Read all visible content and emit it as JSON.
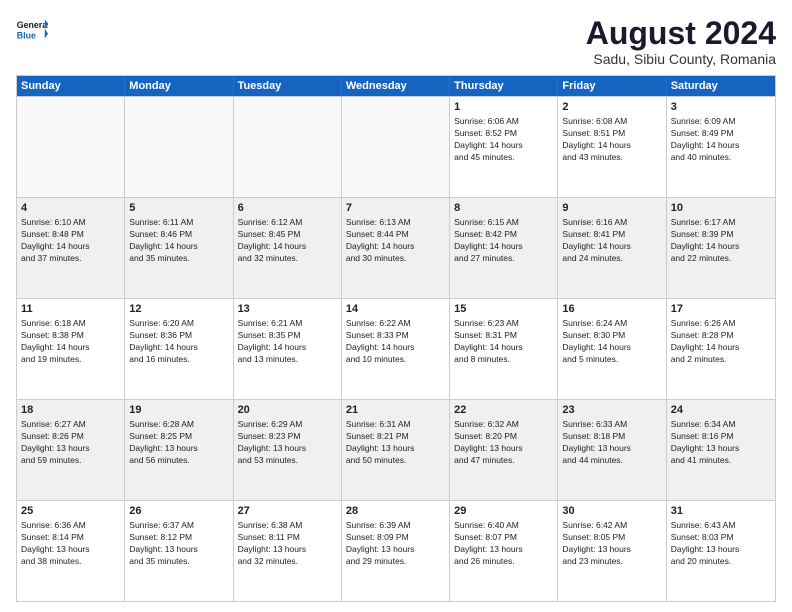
{
  "logo": {
    "line1": "General",
    "line2": "Blue"
  },
  "header": {
    "title": "August 2024",
    "subtitle": "Sadu, Sibiu County, Romania"
  },
  "days": [
    "Sunday",
    "Monday",
    "Tuesday",
    "Wednesday",
    "Thursday",
    "Friday",
    "Saturday"
  ],
  "weeks": [
    [
      {
        "day": "",
        "info": ""
      },
      {
        "day": "",
        "info": ""
      },
      {
        "day": "",
        "info": ""
      },
      {
        "day": "",
        "info": ""
      },
      {
        "day": "1",
        "info": "Sunrise: 6:06 AM\nSunset: 8:52 PM\nDaylight: 14 hours\nand 45 minutes."
      },
      {
        "day": "2",
        "info": "Sunrise: 6:08 AM\nSunset: 8:51 PM\nDaylight: 14 hours\nand 43 minutes."
      },
      {
        "day": "3",
        "info": "Sunrise: 6:09 AM\nSunset: 8:49 PM\nDaylight: 14 hours\nand 40 minutes."
      }
    ],
    [
      {
        "day": "4",
        "info": "Sunrise: 6:10 AM\nSunset: 8:48 PM\nDaylight: 14 hours\nand 37 minutes."
      },
      {
        "day": "5",
        "info": "Sunrise: 6:11 AM\nSunset: 8:46 PM\nDaylight: 14 hours\nand 35 minutes."
      },
      {
        "day": "6",
        "info": "Sunrise: 6:12 AM\nSunset: 8:45 PM\nDaylight: 14 hours\nand 32 minutes."
      },
      {
        "day": "7",
        "info": "Sunrise: 6:13 AM\nSunset: 8:44 PM\nDaylight: 14 hours\nand 30 minutes."
      },
      {
        "day": "8",
        "info": "Sunrise: 6:15 AM\nSunset: 8:42 PM\nDaylight: 14 hours\nand 27 minutes."
      },
      {
        "day": "9",
        "info": "Sunrise: 6:16 AM\nSunset: 8:41 PM\nDaylight: 14 hours\nand 24 minutes."
      },
      {
        "day": "10",
        "info": "Sunrise: 6:17 AM\nSunset: 8:39 PM\nDaylight: 14 hours\nand 22 minutes."
      }
    ],
    [
      {
        "day": "11",
        "info": "Sunrise: 6:18 AM\nSunset: 8:38 PM\nDaylight: 14 hours\nand 19 minutes."
      },
      {
        "day": "12",
        "info": "Sunrise: 6:20 AM\nSunset: 8:36 PM\nDaylight: 14 hours\nand 16 minutes."
      },
      {
        "day": "13",
        "info": "Sunrise: 6:21 AM\nSunset: 8:35 PM\nDaylight: 14 hours\nand 13 minutes."
      },
      {
        "day": "14",
        "info": "Sunrise: 6:22 AM\nSunset: 8:33 PM\nDaylight: 14 hours\nand 10 minutes."
      },
      {
        "day": "15",
        "info": "Sunrise: 6:23 AM\nSunset: 8:31 PM\nDaylight: 14 hours\nand 8 minutes."
      },
      {
        "day": "16",
        "info": "Sunrise: 6:24 AM\nSunset: 8:30 PM\nDaylight: 14 hours\nand 5 minutes."
      },
      {
        "day": "17",
        "info": "Sunrise: 6:26 AM\nSunset: 8:28 PM\nDaylight: 14 hours\nand 2 minutes."
      }
    ],
    [
      {
        "day": "18",
        "info": "Sunrise: 6:27 AM\nSunset: 8:26 PM\nDaylight: 13 hours\nand 59 minutes."
      },
      {
        "day": "19",
        "info": "Sunrise: 6:28 AM\nSunset: 8:25 PM\nDaylight: 13 hours\nand 56 minutes."
      },
      {
        "day": "20",
        "info": "Sunrise: 6:29 AM\nSunset: 8:23 PM\nDaylight: 13 hours\nand 53 minutes."
      },
      {
        "day": "21",
        "info": "Sunrise: 6:31 AM\nSunset: 8:21 PM\nDaylight: 13 hours\nand 50 minutes."
      },
      {
        "day": "22",
        "info": "Sunrise: 6:32 AM\nSunset: 8:20 PM\nDaylight: 13 hours\nand 47 minutes."
      },
      {
        "day": "23",
        "info": "Sunrise: 6:33 AM\nSunset: 8:18 PM\nDaylight: 13 hours\nand 44 minutes."
      },
      {
        "day": "24",
        "info": "Sunrise: 6:34 AM\nSunset: 8:16 PM\nDaylight: 13 hours\nand 41 minutes."
      }
    ],
    [
      {
        "day": "25",
        "info": "Sunrise: 6:36 AM\nSunset: 8:14 PM\nDaylight: 13 hours\nand 38 minutes."
      },
      {
        "day": "26",
        "info": "Sunrise: 6:37 AM\nSunset: 8:12 PM\nDaylight: 13 hours\nand 35 minutes."
      },
      {
        "day": "27",
        "info": "Sunrise: 6:38 AM\nSunset: 8:11 PM\nDaylight: 13 hours\nand 32 minutes."
      },
      {
        "day": "28",
        "info": "Sunrise: 6:39 AM\nSunset: 8:09 PM\nDaylight: 13 hours\nand 29 minutes."
      },
      {
        "day": "29",
        "info": "Sunrise: 6:40 AM\nSunset: 8:07 PM\nDaylight: 13 hours\nand 26 minutes."
      },
      {
        "day": "30",
        "info": "Sunrise: 6:42 AM\nSunset: 8:05 PM\nDaylight: 13 hours\nand 23 minutes."
      },
      {
        "day": "31",
        "info": "Sunrise: 6:43 AM\nSunset: 8:03 PM\nDaylight: 13 hours\nand 20 minutes."
      }
    ]
  ]
}
